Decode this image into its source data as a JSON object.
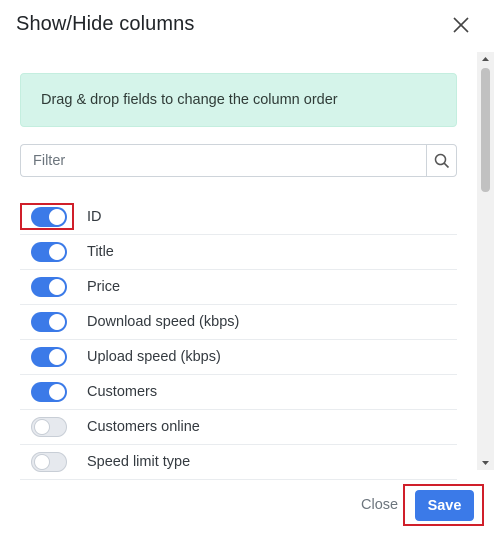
{
  "modal": {
    "title": "Show/Hide columns",
    "close_icon": "close-icon"
  },
  "info": {
    "text": "Drag & drop fields to change the column order"
  },
  "filter": {
    "placeholder": "Filter",
    "value": "",
    "search_icon": "search-icon"
  },
  "columns": [
    {
      "label": "ID",
      "enabled": true
    },
    {
      "label": "Title",
      "enabled": true
    },
    {
      "label": "Price",
      "enabled": true
    },
    {
      "label": "Download speed (kbps)",
      "enabled": true
    },
    {
      "label": "Upload speed (kbps)",
      "enabled": true
    },
    {
      "label": "Customers",
      "enabled": true
    },
    {
      "label": "Customers online",
      "enabled": false
    },
    {
      "label": "Speed limit type",
      "enabled": false
    }
  ],
  "footer": {
    "close_label": "Close",
    "save_label": "Save"
  },
  "colors": {
    "accent": "#3b7ae8",
    "info_background": "#d5f4ea",
    "highlight": "#d01f2a"
  }
}
